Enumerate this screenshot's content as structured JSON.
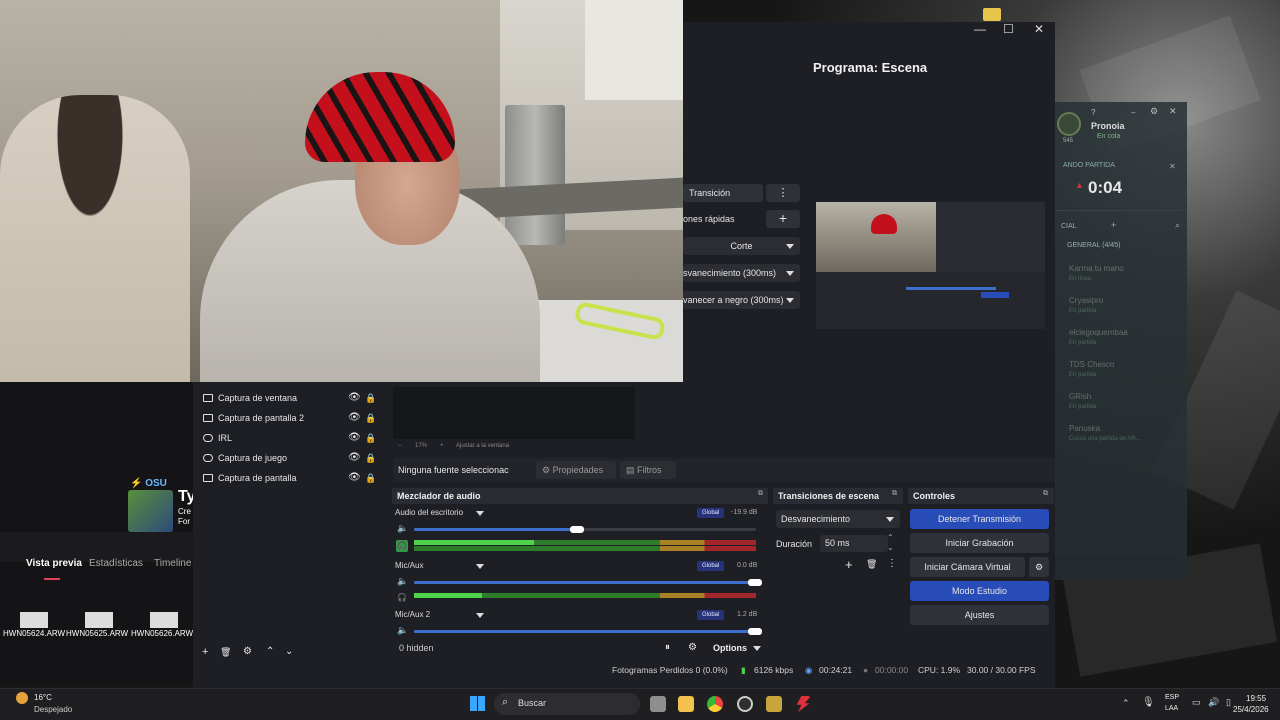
{
  "colors": {
    "accent_blue": "#284cb8",
    "obs_bg": "#1e1f24",
    "taskbar": "#1f1f22"
  },
  "window_controls": {
    "minimize": "—",
    "maximize": "☐",
    "close": "✕"
  },
  "program": {
    "label": "Programa: Escena"
  },
  "transitions_dock": {
    "items": [
      "Transición",
      "ones rápidas",
      "Corte",
      "svanecimiento (300ms)",
      "vanecer a negro (300ms)"
    ]
  },
  "sources": {
    "items": [
      "Captura de ventana",
      "Captura de pantalla 2",
      "IRL",
      "Captura de juego",
      "Captura de pantalla"
    ]
  },
  "preview_zoom": {
    "zoom": "17%",
    "fit": "Ajustar a la ventana"
  },
  "source_toolbar": {
    "none_selected": "Ninguna fuente seleccionac",
    "properties": "Propiedades",
    "filters": "Filtros"
  },
  "mixer": {
    "title": "Mezclador de audio",
    "channels": [
      {
        "name": "Audio del escritorio",
        "badge": "Global",
        "db": "-19.9 dB",
        "volume": 0.48,
        "level": 0.35
      },
      {
        "name": "Mic/Aux",
        "badge": "Global",
        "db": "0.0 dB",
        "volume": 1.0,
        "level": 0.2
      },
      {
        "name": "Mic/Aux 2",
        "badge": "Global",
        "db": "1.2 dB",
        "volume": 1.0,
        "level": 0
      }
    ],
    "scale": [
      "-60",
      "-54",
      "-48",
      "-42",
      "-36",
      "-30",
      "-24",
      "-18",
      "-12",
      "-6",
      "0"
    ],
    "hidden": "0 hidden",
    "options": "Options"
  },
  "scene_transitions": {
    "title": "Transiciones de escena",
    "selected": "Desvanecimiento",
    "duration_label": "Duración",
    "duration_value": "50 ms"
  },
  "controls": {
    "title": "Controles",
    "buttons": [
      "Detener Transmisión",
      "Iniciar Grabación",
      "Iniciar Cámara Virtual",
      "Modo Estudio",
      "Ajustes"
    ]
  },
  "statusbar": {
    "dropped": "Fotogramas Perdidos 0 (0.0%)",
    "bitrate": "6126 kbps",
    "stream_time": "00:24:21",
    "rec_time": "00:00:00",
    "cpu": "CPU: 1.9%",
    "fps": "30.00 / 30.00 FPS"
  },
  "left_dock": {
    "tabs": [
      "Vista previa",
      "Estadísticas",
      "Timeline"
    ],
    "osu_label": "OSU",
    "promo": [
      "Ty",
      "Cre",
      "For"
    ],
    "files": [
      "HWN05624.ARW",
      "HWN05625.ARW",
      "HWN05626.ARW"
    ]
  },
  "sidepanel": {
    "user": "Pronoia",
    "status": "En cola",
    "level": "545",
    "searching": "ANDO PARTIDA",
    "timer": "0:04",
    "social": "CIAL",
    "group": "GENERAL (4/45)",
    "friends": [
      {
        "name": "Karma tu mano",
        "sub": "En línea"
      },
      {
        "name": "Cryasipro",
        "sub": "En partida"
      },
      {
        "name": "elciegoquembaa",
        "sub": "En partida"
      },
      {
        "name": "TDS Chesco",
        "sub": "En partida"
      },
      {
        "name": "GRish",
        "sub": "En partida"
      },
      {
        "name": "Panuska",
        "sub": "Cusca una partida de AR..."
      }
    ]
  },
  "taskbar": {
    "weather_temp": "16°C",
    "weather_desc": "Despejado",
    "search": "Buscar",
    "lang": "ESP",
    "lang2": "LAA",
    "time": "19:55",
    "date": "25/4/2026"
  }
}
